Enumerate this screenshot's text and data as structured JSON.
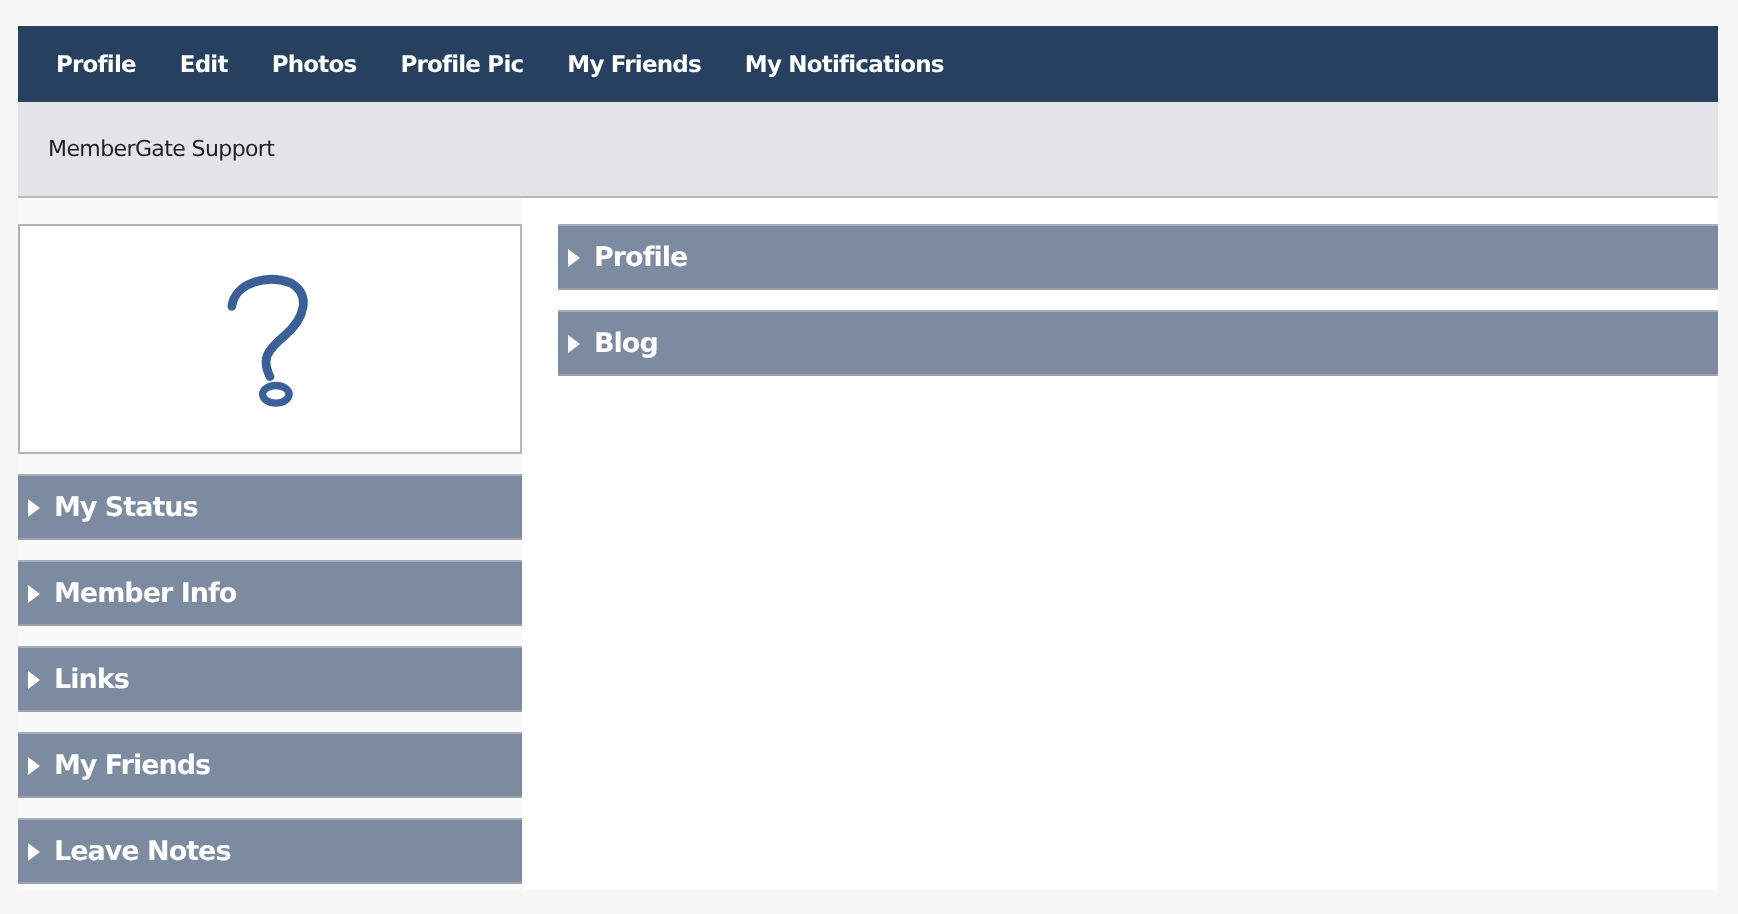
{
  "nav": {
    "items": [
      "Profile",
      "Edit",
      "Photos",
      "Profile Pic",
      "My Friends",
      "My Notifications"
    ]
  },
  "subbar": {
    "title": "MemberGate Support"
  },
  "avatar": {
    "kind": "question-mark"
  },
  "sidebar": {
    "sections": [
      {
        "label": "My Status",
        "expanded": false
      },
      {
        "label": "Member Info",
        "expanded": false
      },
      {
        "label": "Links",
        "expanded": false
      },
      {
        "label": "My Friends",
        "expanded": false
      },
      {
        "label": "Leave Notes",
        "expanded": false
      }
    ]
  },
  "main": {
    "sections": [
      {
        "label": "Profile",
        "expanded": false
      },
      {
        "label": "Blog",
        "expanded": false
      }
    ]
  }
}
